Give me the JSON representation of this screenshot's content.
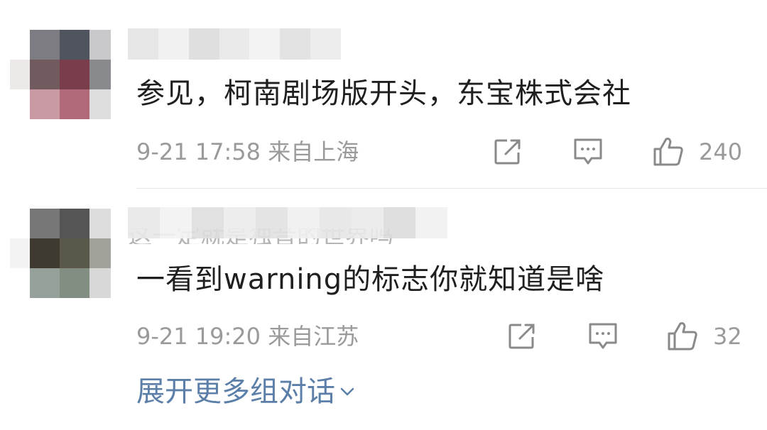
{
  "comments": [
    {
      "text": "参见，柯南剧场版开头，东宝株式会社",
      "time": "9-21 17:58",
      "location": "来自上海",
      "likes": "240",
      "avatar_pixels": [
        "#ffffff",
        "#7d7c82",
        "#50545e",
        "#c9c9cc",
        "#ece9e8",
        "#725b5e",
        "#7a3d4b",
        "#888a8e",
        "#ffffff",
        "#c99aa3",
        "#b06a7a",
        "#dedede"
      ],
      "username_blocks": [
        "#e4e4e4",
        "#f0f0f0",
        "#dcdcdc",
        "#e8e8e8",
        "#f2f2f2",
        "#e0e0e0",
        "#ececec"
      ]
    },
    {
      "text": "一看到warning的标志你就知道是啥",
      "time": "9-21 19:20",
      "location": "来自江苏",
      "likes": "32",
      "hidden_line": "这一定就是独音的世界吗",
      "avatar_pixels": [
        "#ffffff",
        "#777777",
        "#555555",
        "#dddddd",
        "#f3f3f3",
        "#3f3a30",
        "#59584a",
        "#a1a39b",
        "#ffffff",
        "#97a19b",
        "#838e82",
        "#d8d8d8"
      ],
      "username_blocks": [
        "#e8e8e8",
        "#f2f2f2",
        "#dedede",
        "#ececec",
        "#e2e2e2",
        "#f0f0f0",
        "#e6e6e6",
        "#eaeaea",
        "#dcdcdc",
        "#f1f1f1"
      ]
    }
  ],
  "actions": {
    "share_icon": "share-icon",
    "reply_icon": "comment-icon",
    "like_icon": "thumbs-up-icon"
  },
  "expand": {
    "label": "展开更多组对话"
  },
  "colors": {
    "text": "#1f1f1f",
    "meta": "#9a9a9a",
    "icon": "#8a8a8a",
    "link": "#5b7fa8",
    "divider": "#e6e6e6"
  }
}
